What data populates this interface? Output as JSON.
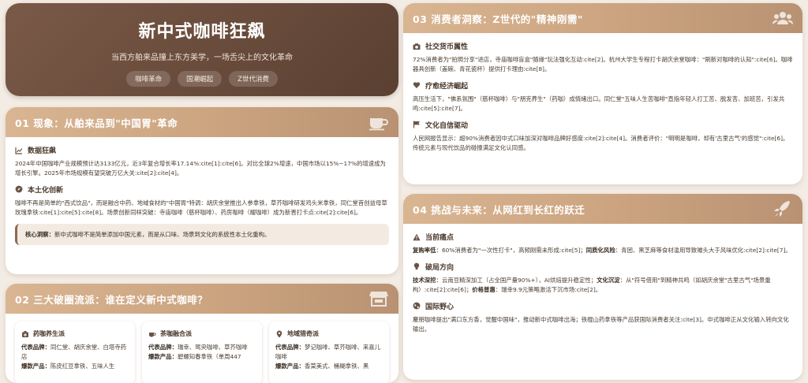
{
  "hero": {
    "title": "新中式咖啡狂飙",
    "subtitle": "当西方舶来品撞上东方美学，一场舌尖上的文化革命",
    "tags": [
      "咖啡革命",
      "国潮崛起",
      "Z世代消费"
    ]
  },
  "card1": {
    "title": "01 现象：从舶来品到\"中国胃\"革命",
    "icon": "coffee-cup-icon",
    "sections": [
      {
        "icon": "chart-line-icon",
        "title": "数据狂飙",
        "text": "2024年中国咖啡产业规模预计达3133亿元，近3年复合增长率17.14%:cite[1]:cite[6]。对比全球2%增速，中国市场以15%~17%的增速成为增长引擎。2025年市场规模有望突破万亿大关:cite[2]:cite[4]。"
      },
      {
        "icon": "compass-icon",
        "title": "本土化创新",
        "text": "咖啡不再是简单的\"西式饮品\"，而是融合中药、地域食材的\"中国胃\"特调：胡庆余堂推出人参拿铁，草芥咖啡研发鸡头米拿铁，同仁堂首创益母草玫瑰拿铁:cite[1]:cite[5]:cite[8]。场景创新同样突破：寺庙咖啡（慈杯咖啡）、药房咖啡（耀咖啡）成为新晋打卡点:cite[2]:cite[6]。"
      }
    ],
    "insight_label": "核心洞察：",
    "insight_text": "新中式咖啡不是简单添加中国元素，而是从口味、场景到文化的系统性本土化重构。"
  },
  "card2": {
    "title": "02 三大破圈流派：谁在定义新中式咖啡？",
    "icon": "shop-icon",
    "schools": [
      {
        "icon": "medicine-box-icon",
        "title": "药咖养生派",
        "brand_label": "代表品牌：",
        "brand_text": "同仁堂、胡庆余堂、白塔寺药店",
        "product_label": "爆款产品：",
        "product_text": "陈皮红豆拿铁、五味人生"
      },
      {
        "icon": "teacup-icon",
        "title": "茶咖融合派",
        "brand_label": "代表品牌：",
        "brand_text": "瑞幸、鸳央咖啡、草芥咖啡",
        "product_label": "爆款产品：",
        "product_text": "碧螺知春拿铁（单周447"
      },
      {
        "icon": "map-pin-icon",
        "title": "地域猎奇派",
        "brand_label": "代表品牌：",
        "brand_text": "梦记咖啡、草芥咖啡、来喜儿咖啡",
        "product_label": "爆款产品：",
        "product_text": "香菜美式、桶糊拿铁、黑"
      }
    ]
  },
  "card3": {
    "title": "03 消费者洞察：Z世代的\"精神刚需\"",
    "icon": "users-icon",
    "sections": [
      {
        "icon": "camera-icon",
        "title": "社交货币属性",
        "text": "72%消费者为\"拍照分享\"进店，寺庙咖啡盲盒\"随缘\"玩法强化互动:cite[2]。杭州大学生专程打卡胡庆余堂咖啡：\"刷新对咖啡的认知\":cite[6]。咖啡器具创新（盖碗、青花瓷杯）提供打卡理由:cite[8]。"
      },
      {
        "icon": "heart-icon",
        "title": "疗愈经济崛起",
        "text": "高压生活下，\"佛系氛围\"（慈杯咖啡）与\"朋克养生\"（药咖）成情绪出口。同仁堂\"五味人生苦咖啡\"直指年轻人打工苦、脱发苦、加班苦，引发共鸣:cite[5]:cite[7]。"
      },
      {
        "icon": "flag-icon",
        "title": "文化自信驱动",
        "text": "人民网报告显示：超90%消费者因中式口味加深对咖啡品牌好感度:cite[2]:cite[4]。消费者评价：\"明明是咖啡，却有'古里古气'的感觉\":cite[6]。传统元素与现代饮品的碰撞满足文化认同感。"
      }
    ]
  },
  "card4": {
    "title": "04 挑战与未来：从网红到长红的跃迁",
    "icon": "rocket-icon",
    "sections": [
      {
        "icon": "warning-icon",
        "title": "当前痛点",
        "parts": [
          {
            "b": "复购率低",
            "t": "：60%消费者为\"一次性打卡\"，高频刚需未形成:cite[5]；"
          },
          {
            "b": "同质化风险",
            "t": "：青团、黑芝麻等食材滥用导致噱头大于风味优化:cite[2]:cite[7]。"
          }
        ]
      },
      {
        "icon": "lightbulb-icon",
        "title": "破局方向",
        "parts": [
          {
            "b": "技术深挖",
            "t": "：云南豆精深加工（占全国产量90%+），AI烘焙提升稳定性；"
          },
          {
            "b": "文化沉淀",
            "t": "：从\"符号借用\"到精神共鸣（如胡庆余堂\"古里古气\"场景重构）:cite[2]:cite[6]；"
          },
          {
            "b": "价格普惠",
            "t": "：瑞幸9.9元策略激活下沉市场:cite[2]。"
          }
        ]
      },
      {
        "icon": "globe-icon",
        "title": "国际野心",
        "parts": [
          {
            "b": "",
            "t": "麈朋咖啡提出\"满口东方香，觉醒中国味\"，推动新中式咖啡出海；铁棍山药拿铁等产品获国际消费者关注:cite[3]。中式咖啡正从文化输入转向文化输出。"
          }
        ]
      }
    ]
  },
  "colors": {
    "hero_bg": "#6b4c3b",
    "header_gold": "#cba37f",
    "accent_brown": "#8c6a50"
  }
}
